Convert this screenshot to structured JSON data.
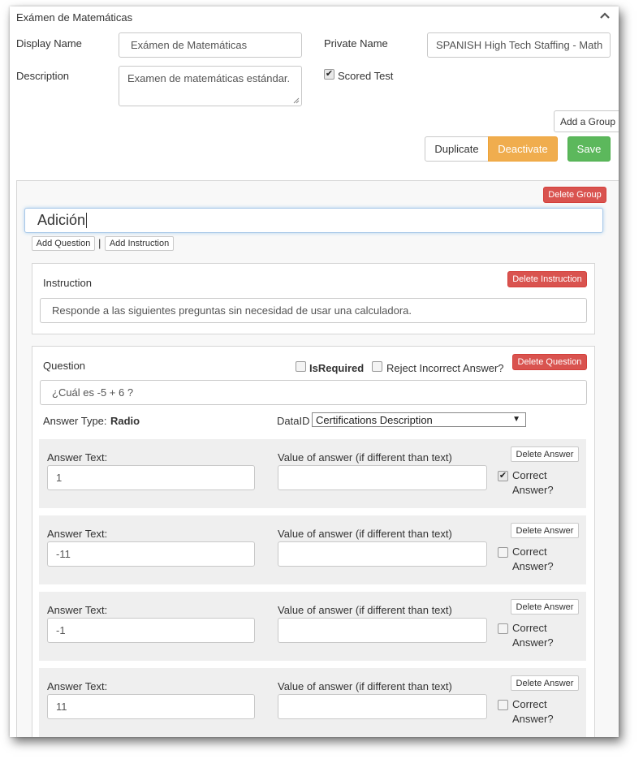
{
  "header": {
    "title": "Exámen de Matemáticas",
    "collapse_icon": "chevron-up-icon"
  },
  "form": {
    "display_name_label": "Display Name",
    "display_name_value": "Exámen de Matemáticas",
    "private_name_label": "Private Name",
    "private_name_value": "SPANISH High Tech Staffing - Math",
    "description_label": "Description",
    "description_value": "Examen de matemáticas estándar.",
    "scored_test_label": "Scored Test",
    "scored_test_checked": true
  },
  "actions": {
    "add_group": "Add a Group",
    "duplicate": "Duplicate",
    "deactivate": "Deactivate",
    "save": "Save"
  },
  "group": {
    "delete_group": "Delete Group",
    "name": "Adición",
    "add_question": "Add Question",
    "separator": "|",
    "add_instruction": "Add Instruction",
    "instruction": {
      "label": "Instruction",
      "delete": "Delete Instruction",
      "text": "Responde a las siguientes preguntas sin necesidad de usar una calculadora."
    },
    "question": {
      "label": "Question",
      "is_required_label": "IsRequired",
      "reject_incorrect_label": "Reject Incorrect Answer?",
      "delete": "Delete Question",
      "text": "¿Cuál es -5 + 6 ?",
      "answer_type_label": "Answer Type:",
      "answer_type_value": "Radio",
      "data_id_label": "DataID",
      "data_id_value": "Certifications Description",
      "answers": [
        {
          "text_label": "Answer Text:",
          "text": "1",
          "value_label": "Value of answer (if different than text)",
          "value": "",
          "delete": "Delete Answer",
          "correct_label": "Correct",
          "correct_label2": "Answer?",
          "correct": true
        },
        {
          "text_label": "Answer Text:",
          "text": "-11",
          "value_label": "Value of answer (if different than text)",
          "value": "",
          "delete": "Delete Answer",
          "correct_label": "Correct",
          "correct_label2": "Answer?",
          "correct": false
        },
        {
          "text_label": "Answer Text:",
          "text": "-1",
          "value_label": "Value of answer (if different than text)",
          "value": "",
          "delete": "Delete Answer",
          "correct_label": "Correct",
          "correct_label2": "Answer?",
          "correct": false
        },
        {
          "text_label": "Answer Text:",
          "text": "11",
          "value_label": "Value of answer (if different than text)",
          "value": "",
          "delete": "Delete Answer",
          "correct_label": "Correct",
          "correct_label2": "Answer?",
          "correct": false
        }
      ]
    }
  }
}
